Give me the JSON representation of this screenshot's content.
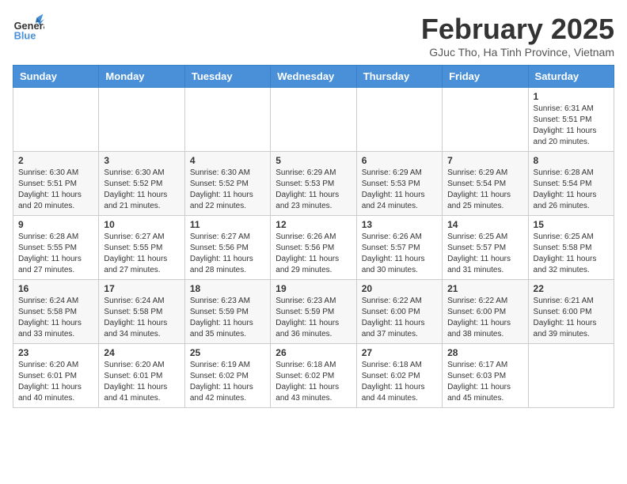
{
  "header": {
    "logo_general": "General",
    "logo_blue": "Blue",
    "month_title": "February 2025",
    "location": "GJuc Tho, Ha Tinh Province, Vietnam"
  },
  "weekdays": [
    "Sunday",
    "Monday",
    "Tuesday",
    "Wednesday",
    "Thursday",
    "Friday",
    "Saturday"
  ],
  "weeks": [
    [
      {
        "day": "",
        "info": ""
      },
      {
        "day": "",
        "info": ""
      },
      {
        "day": "",
        "info": ""
      },
      {
        "day": "",
        "info": ""
      },
      {
        "day": "",
        "info": ""
      },
      {
        "day": "",
        "info": ""
      },
      {
        "day": "1",
        "info": "Sunrise: 6:31 AM\nSunset: 5:51 PM\nDaylight: 11 hours\nand 20 minutes."
      }
    ],
    [
      {
        "day": "2",
        "info": "Sunrise: 6:30 AM\nSunset: 5:51 PM\nDaylight: 11 hours\nand 20 minutes."
      },
      {
        "day": "3",
        "info": "Sunrise: 6:30 AM\nSunset: 5:52 PM\nDaylight: 11 hours\nand 21 minutes."
      },
      {
        "day": "4",
        "info": "Sunrise: 6:30 AM\nSunset: 5:52 PM\nDaylight: 11 hours\nand 22 minutes."
      },
      {
        "day": "5",
        "info": "Sunrise: 6:29 AM\nSunset: 5:53 PM\nDaylight: 11 hours\nand 23 minutes."
      },
      {
        "day": "6",
        "info": "Sunrise: 6:29 AM\nSunset: 5:53 PM\nDaylight: 11 hours\nand 24 minutes."
      },
      {
        "day": "7",
        "info": "Sunrise: 6:29 AM\nSunset: 5:54 PM\nDaylight: 11 hours\nand 25 minutes."
      },
      {
        "day": "8",
        "info": "Sunrise: 6:28 AM\nSunset: 5:54 PM\nDaylight: 11 hours\nand 26 minutes."
      }
    ],
    [
      {
        "day": "9",
        "info": "Sunrise: 6:28 AM\nSunset: 5:55 PM\nDaylight: 11 hours\nand 27 minutes."
      },
      {
        "day": "10",
        "info": "Sunrise: 6:27 AM\nSunset: 5:55 PM\nDaylight: 11 hours\nand 27 minutes."
      },
      {
        "day": "11",
        "info": "Sunrise: 6:27 AM\nSunset: 5:56 PM\nDaylight: 11 hours\nand 28 minutes."
      },
      {
        "day": "12",
        "info": "Sunrise: 6:26 AM\nSunset: 5:56 PM\nDaylight: 11 hours\nand 29 minutes."
      },
      {
        "day": "13",
        "info": "Sunrise: 6:26 AM\nSunset: 5:57 PM\nDaylight: 11 hours\nand 30 minutes."
      },
      {
        "day": "14",
        "info": "Sunrise: 6:25 AM\nSunset: 5:57 PM\nDaylight: 11 hours\nand 31 minutes."
      },
      {
        "day": "15",
        "info": "Sunrise: 6:25 AM\nSunset: 5:58 PM\nDaylight: 11 hours\nand 32 minutes."
      }
    ],
    [
      {
        "day": "16",
        "info": "Sunrise: 6:24 AM\nSunset: 5:58 PM\nDaylight: 11 hours\nand 33 minutes."
      },
      {
        "day": "17",
        "info": "Sunrise: 6:24 AM\nSunset: 5:58 PM\nDaylight: 11 hours\nand 34 minutes."
      },
      {
        "day": "18",
        "info": "Sunrise: 6:23 AM\nSunset: 5:59 PM\nDaylight: 11 hours\nand 35 minutes."
      },
      {
        "day": "19",
        "info": "Sunrise: 6:23 AM\nSunset: 5:59 PM\nDaylight: 11 hours\nand 36 minutes."
      },
      {
        "day": "20",
        "info": "Sunrise: 6:22 AM\nSunset: 6:00 PM\nDaylight: 11 hours\nand 37 minutes."
      },
      {
        "day": "21",
        "info": "Sunrise: 6:22 AM\nSunset: 6:00 PM\nDaylight: 11 hours\nand 38 minutes."
      },
      {
        "day": "22",
        "info": "Sunrise: 6:21 AM\nSunset: 6:00 PM\nDaylight: 11 hours\nand 39 minutes."
      }
    ],
    [
      {
        "day": "23",
        "info": "Sunrise: 6:20 AM\nSunset: 6:01 PM\nDaylight: 11 hours\nand 40 minutes."
      },
      {
        "day": "24",
        "info": "Sunrise: 6:20 AM\nSunset: 6:01 PM\nDaylight: 11 hours\nand 41 minutes."
      },
      {
        "day": "25",
        "info": "Sunrise: 6:19 AM\nSunset: 6:02 PM\nDaylight: 11 hours\nand 42 minutes."
      },
      {
        "day": "26",
        "info": "Sunrise: 6:18 AM\nSunset: 6:02 PM\nDaylight: 11 hours\nand 43 minutes."
      },
      {
        "day": "27",
        "info": "Sunrise: 6:18 AM\nSunset: 6:02 PM\nDaylight: 11 hours\nand 44 minutes."
      },
      {
        "day": "28",
        "info": "Sunrise: 6:17 AM\nSunset: 6:03 PM\nDaylight: 11 hours\nand 45 minutes."
      },
      {
        "day": "",
        "info": ""
      }
    ]
  ]
}
